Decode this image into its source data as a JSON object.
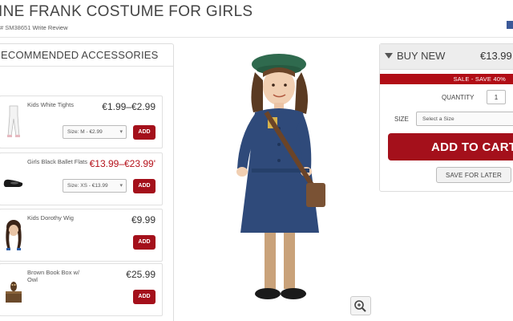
{
  "header": {
    "title": "INE FRANK COSTUME FOR GIRLS",
    "sku": "# SM38651",
    "review_link": "Write Review"
  },
  "accessories": {
    "heading": "ECOMMENDED ACCESSORIES",
    "items": [
      {
        "name": "Kids White Tights",
        "price": "€1.99–€2.99",
        "size_select": "Size: M - €2.99",
        "add_label": "ADD",
        "thumb_icon": "tights-icon"
      },
      {
        "name": "Girls Black Ballet Flats",
        "price": "€13.99–€23.99'",
        "size_select": "Size: XS - €13.99",
        "add_label": "ADD",
        "thumb_icon": "shoes-icon"
      },
      {
        "name": "Kids Dorothy Wig",
        "price": "€9.99",
        "add_label": "ADD",
        "thumb_icon": "wig-icon"
      },
      {
        "name": "Brown Book Box w/ Owl",
        "price": "€25.99",
        "add_label": "ADD",
        "thumb_icon": "book-box-icon"
      }
    ]
  },
  "buy": {
    "heading": "BUY NEW",
    "price": "€13.99",
    "sale_text": "SALE - SAVE 40%",
    "quantity_label": "QUANTITY",
    "quantity_value": "1",
    "size_label": "SIZE",
    "size_placeholder": "Select a Size",
    "add_to_cart": "ADD TO CART",
    "save_for_later": "SAVE FOR LATER"
  },
  "colors": {
    "accent": "#a4101b",
    "sale_bar": "#b10d16",
    "costume": "#2f4a7a",
    "beret": "#2f6a4e"
  },
  "icons": {
    "zoom": "zoom-in-icon",
    "buy_toggle": "triangle-down-icon"
  }
}
